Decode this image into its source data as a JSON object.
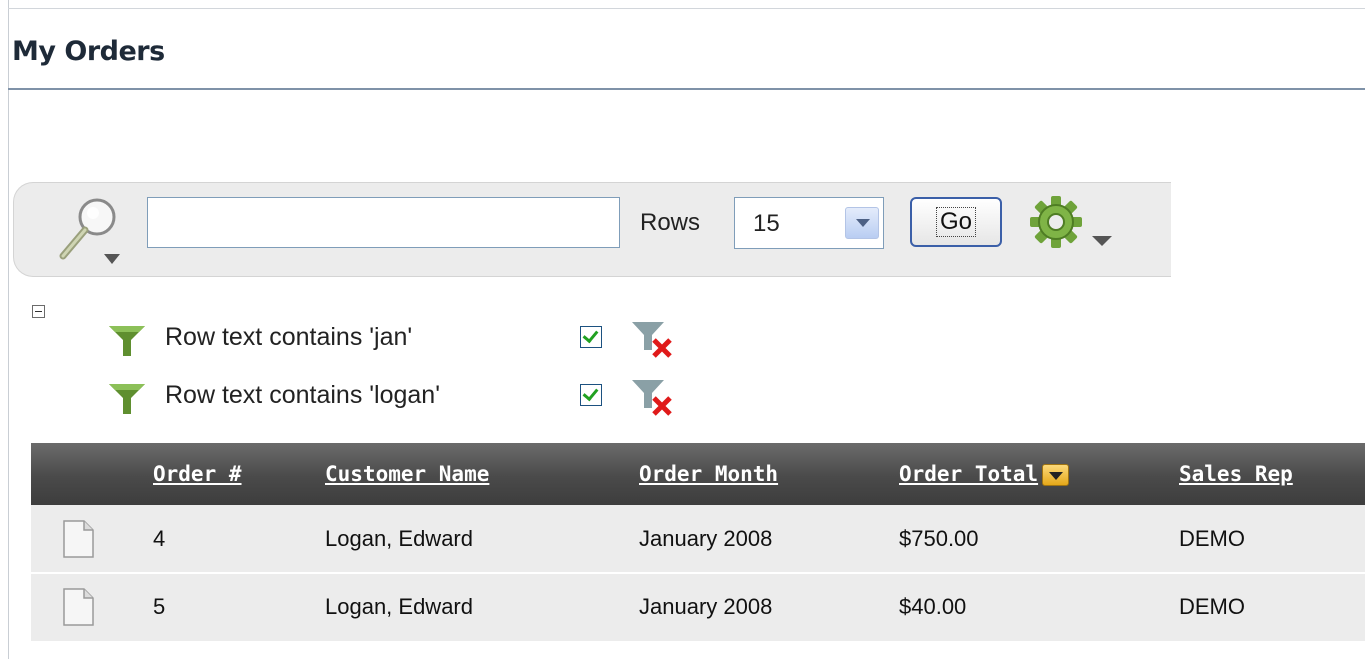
{
  "page": {
    "title": "My Orders"
  },
  "search": {
    "value": "",
    "rows_label": "Rows",
    "rows_value": "15",
    "go_label": "Go"
  },
  "filters": [
    {
      "label": "Row text contains 'jan'",
      "enabled": true
    },
    {
      "label": "Row text contains 'logan'",
      "enabled": true
    }
  ],
  "table": {
    "columns": [
      "Order #",
      "Customer Name",
      "Order Month",
      "Order Total",
      "Sales Rep"
    ],
    "rows": [
      [
        "4",
        "Logan, Edward",
        "January 2008",
        "$750.00",
        "DEMO"
      ],
      [
        "5",
        "Logan, Edward",
        "January 2008",
        "$40.00",
        "DEMO"
      ]
    ]
  },
  "colors": {
    "title_rule": "#7f92a8",
    "header_bg": "#4a4a4a",
    "row_bg": "#ececec",
    "go_border": "#3b5fa8"
  }
}
